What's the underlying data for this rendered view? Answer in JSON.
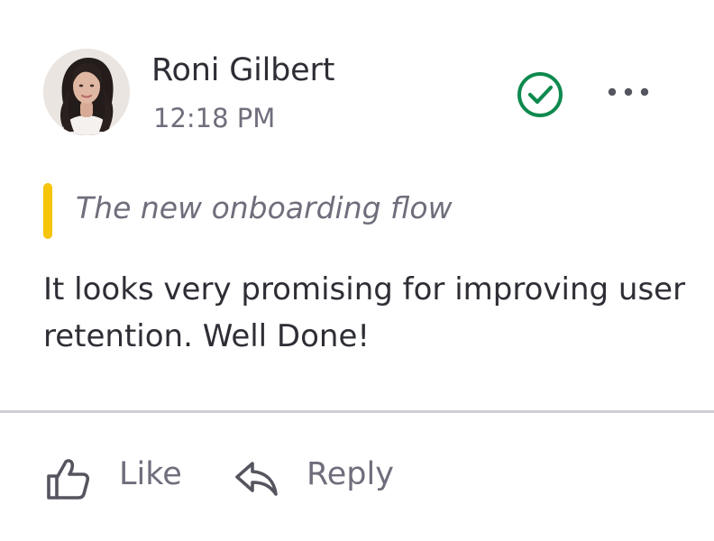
{
  "comment": {
    "author": {
      "name": "Roni Gilbert",
      "avatar_icon": "person-photo"
    },
    "timestamp": "12:18 PM",
    "status": {
      "icon": "check-circle-icon",
      "color": "#0f8a4f"
    },
    "menu_icon": "more-horizontal-icon",
    "quote": {
      "text": "The new onboarding flow",
      "accent_color": "#f6c409"
    },
    "body": "It looks very promising for improving user retention. Well Done!"
  },
  "actions": {
    "like": {
      "label": "Like",
      "icon": "thumbs-up-icon"
    },
    "reply": {
      "label": "Reply",
      "icon": "reply-icon"
    }
  },
  "colors": {
    "text_primary": "#2e2e36",
    "text_secondary": "#6e6e7c",
    "divider": "#cdced6"
  }
}
